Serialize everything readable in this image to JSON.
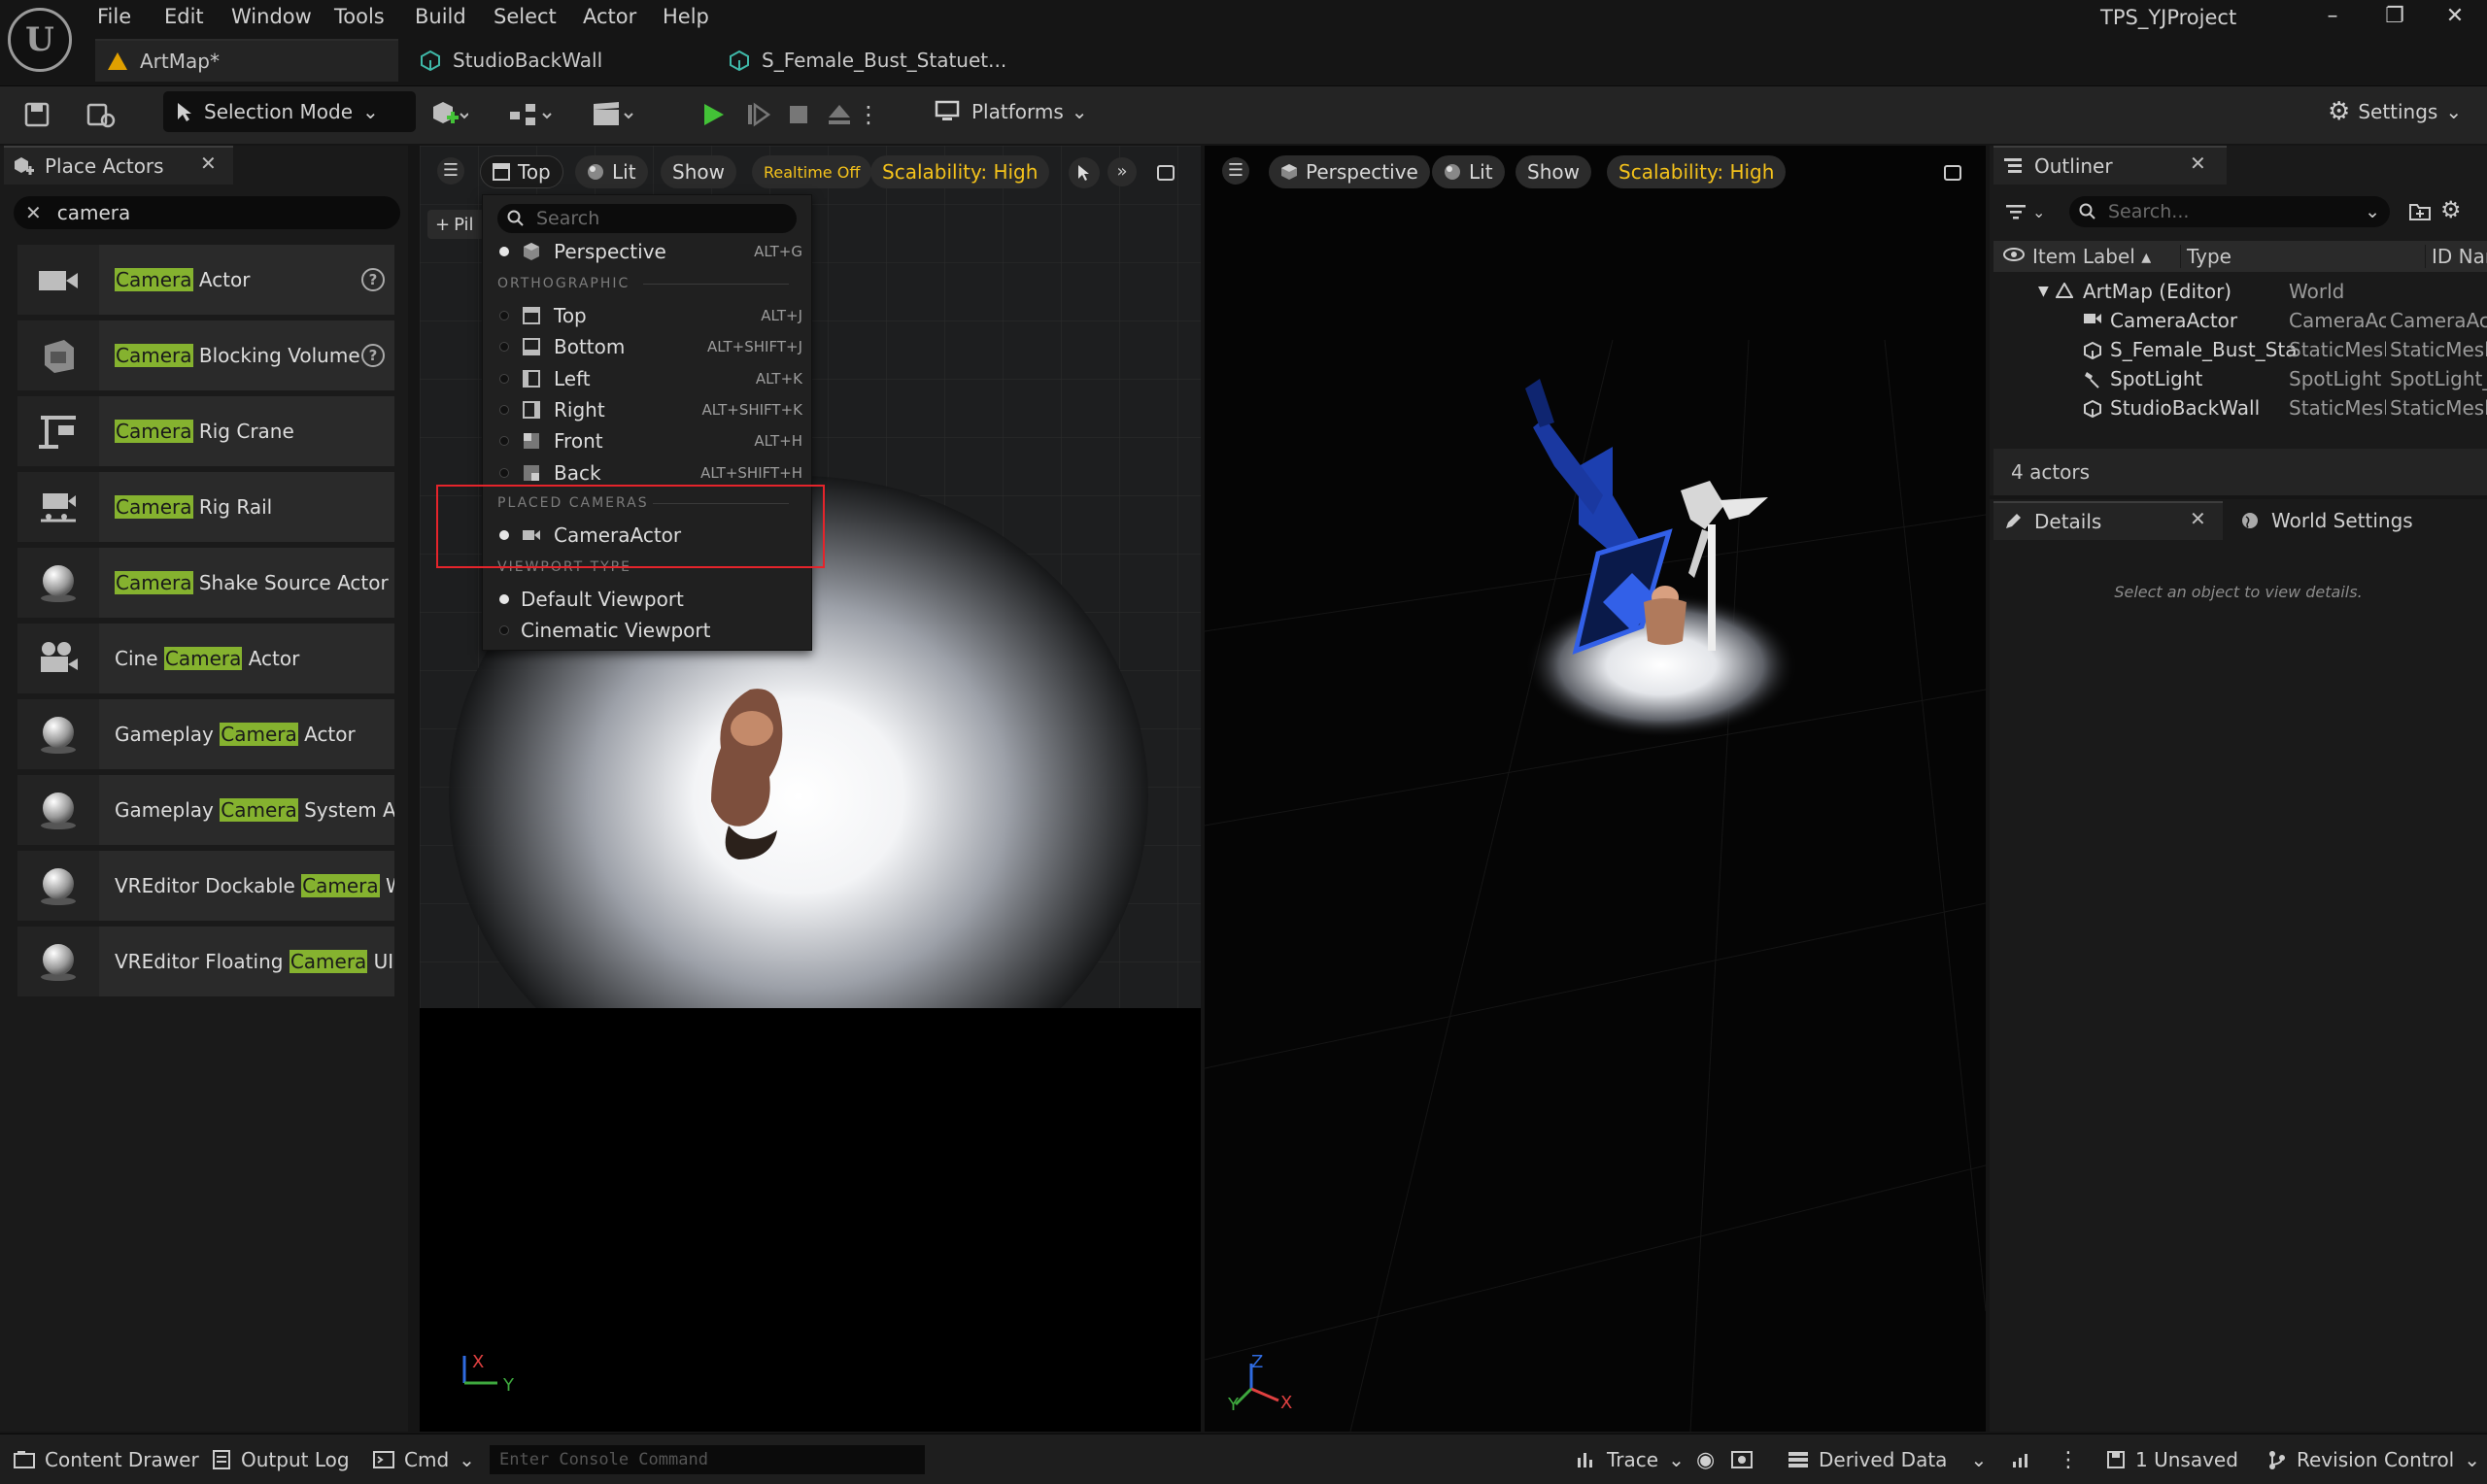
{
  "app": {
    "project_title": "TPS_YJProject",
    "menu": [
      "File",
      "Edit",
      "Window",
      "Tools",
      "Build",
      "Select",
      "Actor",
      "Help"
    ],
    "tabs": [
      "ArtMap*",
      "StudioBackWall",
      "S_Female_Bust_Statuet..."
    ]
  },
  "toolbar": {
    "selection_mode": "Selection Mode",
    "platforms": "Platforms",
    "settings": "Settings"
  },
  "place_actors": {
    "tab_label": "Place Actors",
    "search_value": "camera",
    "items": [
      {
        "pre": "",
        "hl": "Camera",
        "post": " Actor",
        "help": true
      },
      {
        "pre": "",
        "hl": "Camera",
        "post": " Blocking Volume",
        "help": true
      },
      {
        "pre": "",
        "hl": "Camera",
        "post": " Rig Crane",
        "help": false
      },
      {
        "pre": "",
        "hl": "Camera",
        "post": " Rig Rail",
        "help": false
      },
      {
        "pre": "",
        "hl": "Camera",
        "post": " Shake Source Actor",
        "help": false
      },
      {
        "pre": "Cine ",
        "hl": "Camera",
        "post": " Actor",
        "help": false
      },
      {
        "pre": "Gameplay ",
        "hl": "Camera",
        "post": " Actor",
        "help": false
      },
      {
        "pre": "Gameplay ",
        "hl": "Camera",
        "post": " System Actor",
        "help": false
      },
      {
        "pre": "VREditor Dockable ",
        "hl": "Camera",
        "post": " Wind",
        "help": false
      },
      {
        "pre": "VREditor Floating ",
        "hl": "Camera",
        "post": " UI",
        "help": false
      }
    ]
  },
  "viewport_left": {
    "view": "Top",
    "lit": "Lit",
    "show": "Show",
    "realtime": "Realtime Off",
    "scalability": "Scalability: High",
    "pilot": "Pil",
    "axis_x": "X",
    "axis_y": "Y"
  },
  "viewport_right": {
    "view": "Perspective",
    "lit": "Lit",
    "show": "Show",
    "scalability": "Scalability: High",
    "axis_x": "X",
    "axis_y": "Y",
    "axis_z": "Z"
  },
  "view_menu": {
    "search_placeholder": "Search",
    "perspective": {
      "label": "Perspective",
      "shortcut": "ALT+G"
    },
    "orthographic_heading": "ORTHOGRAPHIC",
    "ortho_items": [
      {
        "label": "Top",
        "shortcut": "ALT+J"
      },
      {
        "label": "Bottom",
        "shortcut": "ALT+SHIFT+J"
      },
      {
        "label": "Left",
        "shortcut": "ALT+K"
      },
      {
        "label": "Right",
        "shortcut": "ALT+SHIFT+K"
      },
      {
        "label": "Front",
        "shortcut": "ALT+H"
      },
      {
        "label": "Back",
        "shortcut": "ALT+SHIFT+H"
      }
    ],
    "placed_cameras_heading": "PLACED CAMERAS",
    "placed_camera": "CameraActor",
    "viewport_type_heading": "VIEWPORT TYPE",
    "viewport_types": [
      "Default Viewport",
      "Cinematic Viewport"
    ]
  },
  "outliner": {
    "tab_label": "Outliner",
    "search_placeholder": "Search...",
    "columns": [
      "Item Label",
      "Type",
      "ID Name"
    ],
    "rows": [
      {
        "label": "ArtMap (Editor)",
        "type": "World",
        "id": ""
      },
      {
        "label": "CameraActor",
        "type": "CameraAc",
        "id": "CameraAc"
      },
      {
        "label": "S_Female_Bust_Sta",
        "type": "StaticMesl",
        "id": "StaticMesl"
      },
      {
        "label": "SpotLight",
        "type": "SpotLight",
        "id": "SpotLight_"
      },
      {
        "label": "StudioBackWall",
        "type": "StaticMesl",
        "id": "StaticMesl"
      }
    ],
    "count": "4 actors"
  },
  "details": {
    "tab_label": "Details",
    "world_settings": "World Settings",
    "empty_message": "Select an object to view details."
  },
  "statusbar": {
    "content_drawer": "Content Drawer",
    "output_log": "Output Log",
    "cmd": "Cmd",
    "console_placeholder": "Enter Console Command",
    "trace": "Trace",
    "derived_data": "Derived Data",
    "unsaved": "1 Unsaved",
    "revision_control": "Revision Control"
  },
  "colors": {
    "highlight": "#85b22f",
    "play": "#43c237",
    "scalability": "#f4c21b",
    "annotation": "#e5242b"
  }
}
